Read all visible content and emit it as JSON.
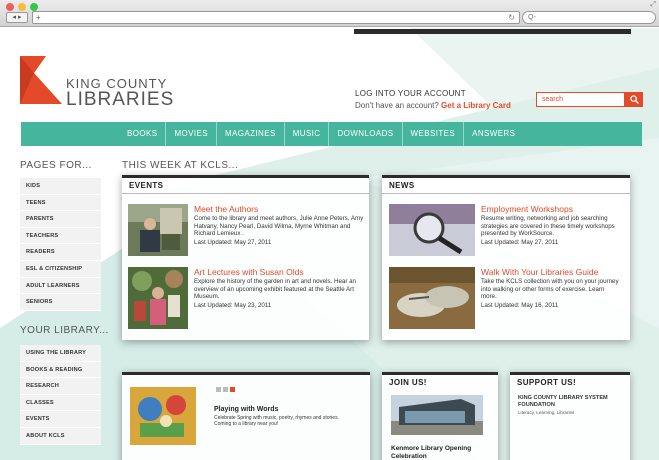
{
  "browser": {
    "url": "+",
    "search_placeholder": "Q-"
  },
  "brand": {
    "line1": "KING COUNTY",
    "line2": "LIBRARIES",
    "accent": "#e34a2a",
    "teal": "#45b59d"
  },
  "account": {
    "title": "LOG INTO YOUR ACCOUNT",
    "prompt": "Don't have an account?",
    "link": "Get a Library Card"
  },
  "search": {
    "placeholder": "search"
  },
  "nav": [
    "BOOKS",
    "MOVIES",
    "MAGAZINES",
    "MUSIC",
    "DOWNLOADS",
    "WEBSITES",
    "ANSWERS"
  ],
  "pages_for": {
    "heading": "PAGES FOR...",
    "items": [
      "KIDS",
      "TEENS",
      "PARENTS",
      "TEACHERS",
      "READERS",
      "ESL & CITIZENSHIP",
      "ADULT LEARNERS",
      "SENIORS"
    ]
  },
  "your_library": {
    "heading": "YOUR LIBRARY...",
    "items": [
      "USING THE LIBRARY",
      "BOOKS & READING",
      "RESEARCH",
      "CLASSES",
      "EVENTS",
      "ABOUT KCLS"
    ]
  },
  "week_heading": "THIS WEEK AT KCLS...",
  "events": {
    "title": "EVENTS",
    "items": [
      {
        "title": "Meet the Authors",
        "desc": "Come to the library and meet authors, Julie Anne Peters, Amy Hatvany, Nancy Pearl, David Wilma, Myrne Whitman and Richard Lemieux .",
        "date": "Last Updated: May 27, 2011"
      },
      {
        "title": "Art Lectures with Susan Olds",
        "desc": "Explore the history of the garden in art and novels. Hear an overview of an upcoming exhibit featured at the Seattle Art Museum.",
        "date": "Last Updated: May 23, 2011"
      }
    ]
  },
  "news": {
    "title": "NEWS",
    "items": [
      {
        "title": "Employment Workshops",
        "desc": "Resume writing, networking and job searching strategies are covered in these timely workshops presented by WorkSource.",
        "date": "Last Updated: May 27, 2011"
      },
      {
        "title": "Walk With Your Libraries Guide",
        "desc": "Take the KCLS collection with you on your journey into walking or other forms of exercise. Learn more.",
        "date": "Last Updated: May 16, 2011"
      }
    ]
  },
  "feature": {
    "title": "Playing with Words",
    "desc": "Celebrate Spring with music, poetry, rhymes and stories. Coming to a library near you!"
  },
  "join": {
    "title": "JOIN US!",
    "caption": "Kenmore Library Opening Celebration"
  },
  "support": {
    "title": "SUPPORT US!",
    "org": "KING COUNTY LIBRARY SYSTEM FOUNDATION",
    "tagline": "Literacy, Learning, Libraries"
  }
}
